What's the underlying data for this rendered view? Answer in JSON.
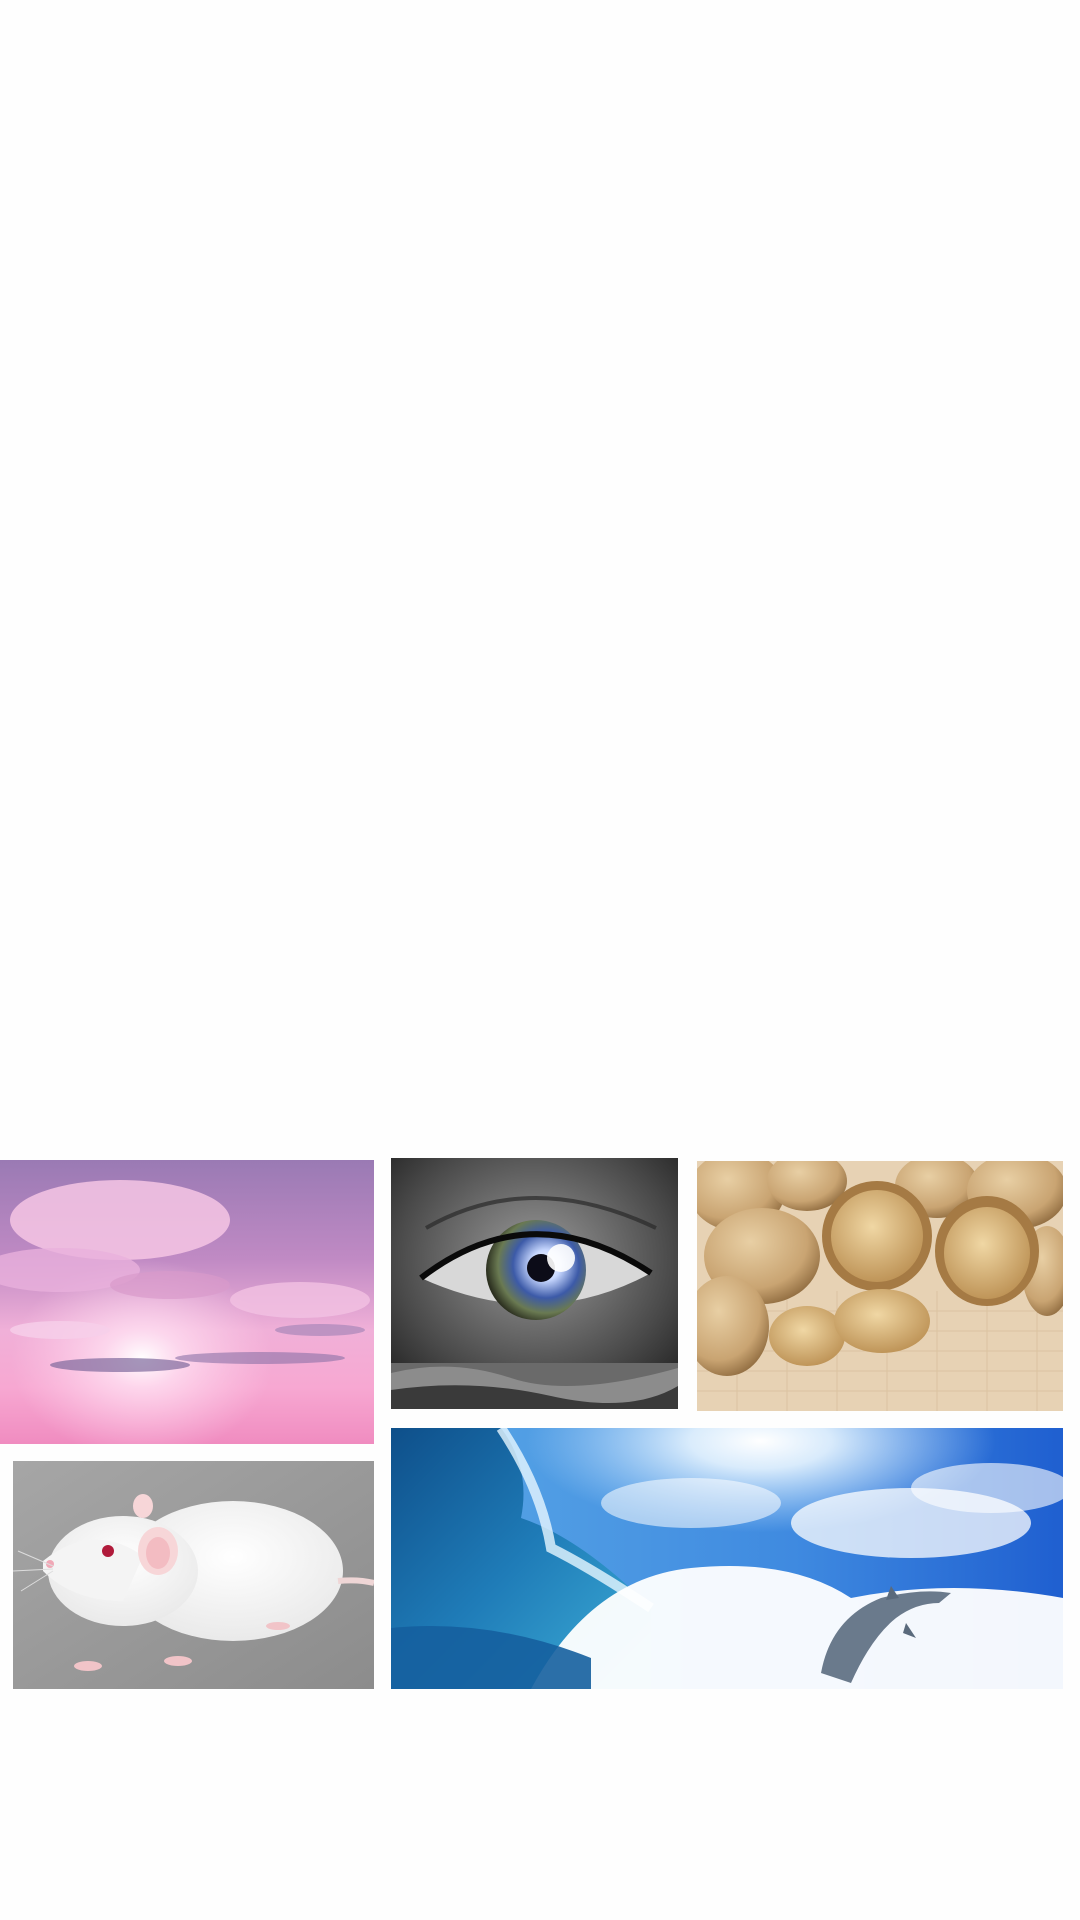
{
  "gallery": {
    "tiles": [
      {
        "subject": "pink-sunset-sky",
        "accent": "#e58ec4"
      },
      {
        "subject": "eye-close-up",
        "accent": "#4a6bc8"
      },
      {
        "subject": "walnuts",
        "accent": "#c89858"
      },
      {
        "subject": "white-rat",
        "accent": "#f4f4f4"
      },
      {
        "subject": "wave-and-dolphin",
        "accent": "#2f7fcf"
      }
    ]
  },
  "colors": {
    "background": "#fefefe"
  }
}
